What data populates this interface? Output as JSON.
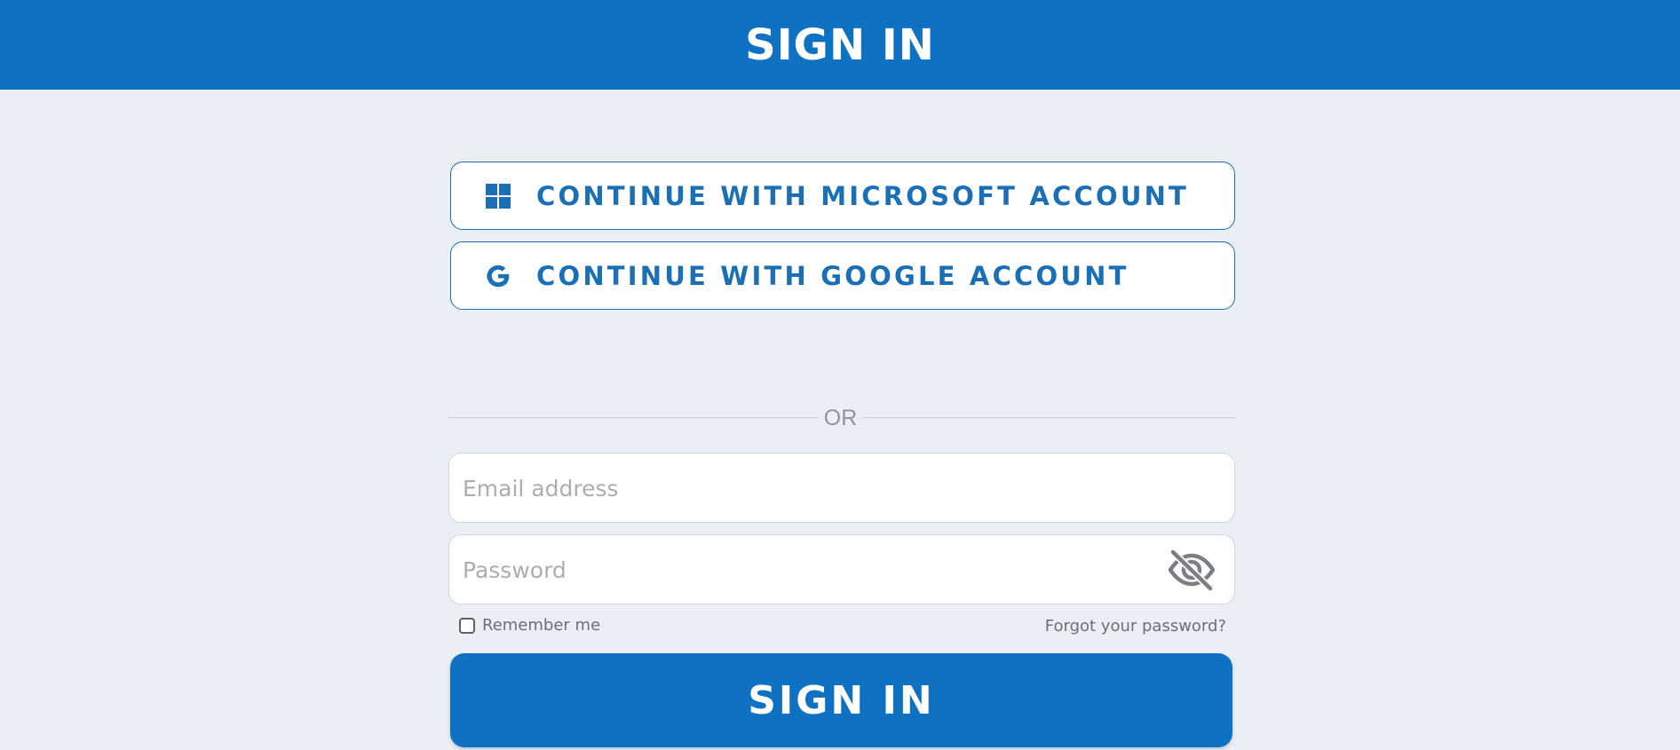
{
  "header": {
    "title": "SIGN IN"
  },
  "sso": {
    "microsoft": {
      "label": "CONTINUE WITH MICROSOFT ACCOUNT",
      "icon": "windows-logo-icon"
    },
    "google": {
      "label": "CONTINUE WITH GOOGLE ACCOUNT",
      "icon": "google-logo-icon"
    }
  },
  "divider": {
    "text": "OR"
  },
  "form": {
    "email": {
      "placeholder": "Email address",
      "value": ""
    },
    "password": {
      "placeholder": "Password",
      "value": "",
      "toggle_icon": "eye-slash-icon"
    },
    "remember_label": "Remember me",
    "remember_checked": false,
    "forgot_label": "Forgot your password?",
    "submit_label": "SIGN IN"
  },
  "colors": {
    "brand": "#0f71c2",
    "background": "#e9eff4",
    "muted_text": "#6c7075"
  }
}
